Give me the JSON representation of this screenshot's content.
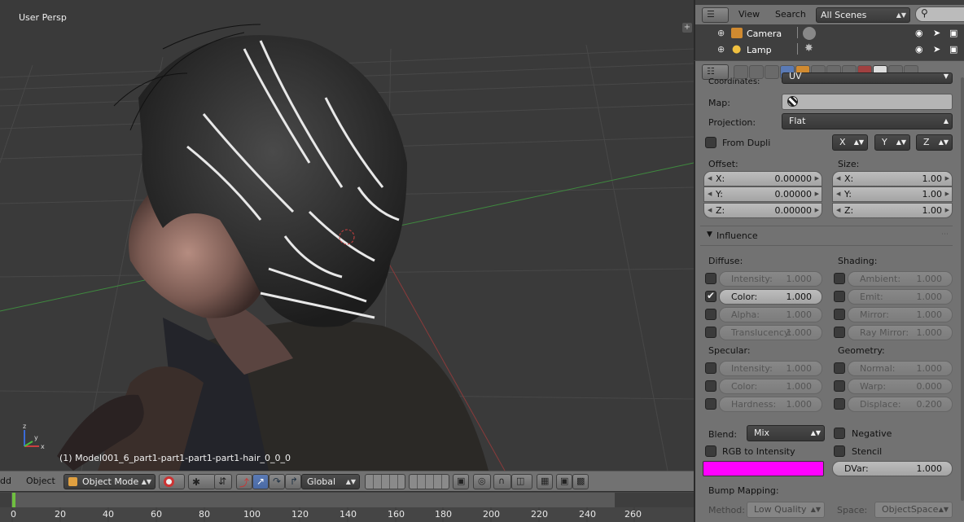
{
  "viewport": {
    "view_label": "User Persp",
    "object_label": "(1) Model001_6_part1-part1-part1-part1-hair_0_0_0",
    "plus_label": "+",
    "axis_z": "z",
    "axis_y": "y",
    "axis_x": "x",
    "header": {
      "add_menu": "dd",
      "object_menu": "Object",
      "mode": "Object Mode",
      "orientation": "Global"
    }
  },
  "timeline": {
    "ticks": [
      "0",
      "20",
      "40",
      "60",
      "80",
      "100",
      "120",
      "140",
      "160",
      "180",
      "200",
      "220",
      "240",
      "260"
    ],
    "current_frame_color": "#6fbf40"
  },
  "outliner": {
    "view_menu": "View",
    "search_menu": "Search",
    "scene_filter": "All Scenes",
    "rows": [
      {
        "name": "Camera"
      },
      {
        "name": "Lamp"
      }
    ]
  },
  "properties": {
    "coordinates_label": "Coordinates:",
    "coordinates_value": "UV",
    "map_label": "Map:",
    "projection_label": "Projection:",
    "projection_value": "Flat",
    "from_dupli_label": "From Dupli",
    "proj_x": "X",
    "proj_y": "Y",
    "proj_z": "Z",
    "offset_label": "Offset:",
    "size_label": "Size:",
    "offset": [
      {
        "axis": "X:",
        "value": "0.00000"
      },
      {
        "axis": "Y:",
        "value": "0.00000"
      },
      {
        "axis": "Z:",
        "value": "0.00000"
      }
    ],
    "size": [
      {
        "axis": "X:",
        "value": "1.00"
      },
      {
        "axis": "Y:",
        "value": "1.00"
      },
      {
        "axis": "Z:",
        "value": "1.00"
      }
    ],
    "influence_title": "Influence",
    "diffuse_label": "Diffuse:",
    "shading_label": "Shading:",
    "diffuse": [
      {
        "name": "Intensity:",
        "value": "1.000",
        "checked": false
      },
      {
        "name": "Color:",
        "value": "1.000",
        "checked": true
      },
      {
        "name": "Alpha:",
        "value": "1.000",
        "checked": false
      },
      {
        "name": "Translucency:",
        "value": "1.000",
        "checked": false
      }
    ],
    "shading": [
      {
        "name": "Ambient:",
        "value": "1.000"
      },
      {
        "name": "Emit:",
        "value": "1.000"
      },
      {
        "name": "Mirror:",
        "value": "1.000"
      },
      {
        "name": "Ray Mirror:",
        "value": "1.000"
      }
    ],
    "specular_label": "Specular:",
    "geometry_label": "Geometry:",
    "specular": [
      {
        "name": "Intensity:",
        "value": "1.000"
      },
      {
        "name": "Color:",
        "value": "1.000"
      },
      {
        "name": "Hardness:",
        "value": "1.000"
      }
    ],
    "geometry": [
      {
        "name": "Normal:",
        "value": "1.000"
      },
      {
        "name": "Warp:",
        "value": "0.000"
      },
      {
        "name": "Displace:",
        "value": "0.200"
      }
    ],
    "blend_label": "Blend:",
    "blend_value": "Mix",
    "negative_label": "Negative",
    "rgb_label": "RGB to Intensity",
    "stencil_label": "Stencil",
    "color_swatch": "#ff00ff",
    "dvar_label": "DVar:",
    "dvar_value": "1.000",
    "bump_label": "Bump Mapping:",
    "method_label": "Method:",
    "method_value": "Low Quality",
    "space_label": "Space:",
    "space_value": "ObjectSpace"
  }
}
